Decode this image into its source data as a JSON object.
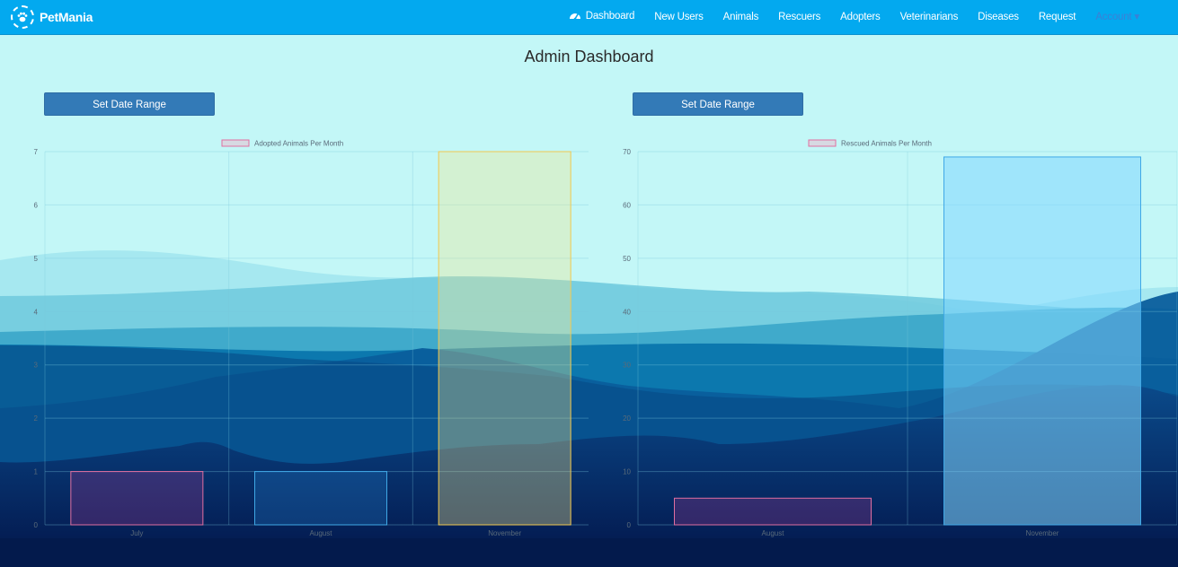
{
  "brand": {
    "name": "PetMania"
  },
  "nav": {
    "items": [
      {
        "label": "Dashboard",
        "icon": "dashboard-icon",
        "active": true
      },
      {
        "label": "New Users"
      },
      {
        "label": "Animals"
      },
      {
        "label": "Rescuers"
      },
      {
        "label": "Adopters"
      },
      {
        "label": "Veterinarians"
      },
      {
        "label": "Diseases"
      },
      {
        "label": "Request"
      },
      {
        "label": "Account"
      }
    ]
  },
  "page": {
    "title": "Admin Dashboard"
  },
  "left_panel": {
    "button_label": "Set Date Range"
  },
  "right_panel": {
    "button_label": "Set Date Range"
  },
  "colors": {
    "navbar": "#03a9ef",
    "button": "#337ab7",
    "bar_pink_border": "#e06fa0",
    "bar_blue_border": "#3fa8e6",
    "bar_yellow_border": "#f0c850"
  },
  "chart_data": [
    {
      "type": "bar",
      "legend": "Adopted Animals Per Month",
      "categories": [
        "July",
        "August",
        "November"
      ],
      "values": [
        1,
        1,
        7
      ],
      "ylim": [
        0,
        7
      ],
      "yticks": [
        0,
        1,
        2,
        3,
        4,
        5,
        6,
        7
      ],
      "grid": true,
      "legend_position": "top"
    },
    {
      "type": "bar",
      "legend": "Rescued Animals Per Month",
      "categories": [
        "August",
        "November"
      ],
      "values": [
        5,
        69
      ],
      "ylim": [
        0,
        70
      ],
      "yticks": [
        0,
        10,
        20,
        30,
        40,
        50,
        60,
        70
      ],
      "grid": true,
      "legend_position": "top"
    }
  ]
}
